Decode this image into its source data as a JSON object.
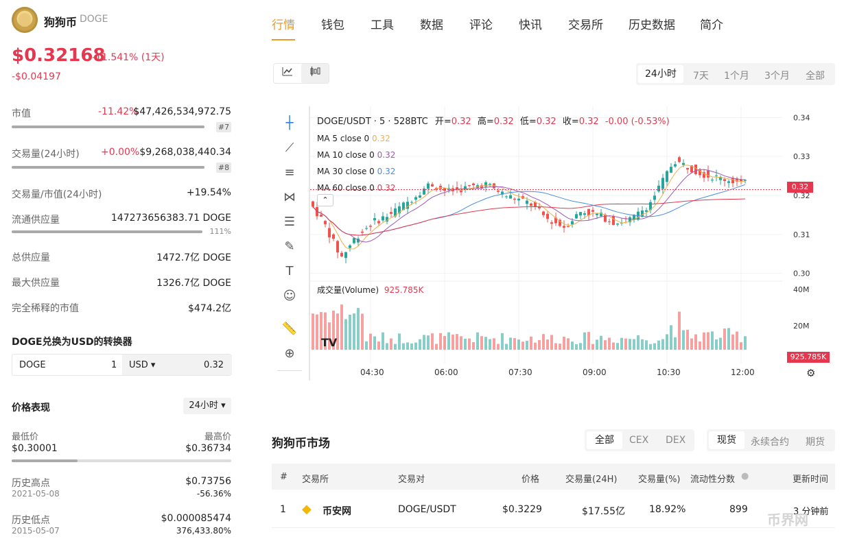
{
  "coin": {
    "name": "狗狗币",
    "symbol": "DOGE",
    "price": "$0.32168",
    "change_pct": "-11.541% (1天)",
    "change_abs": "-$0.04197"
  },
  "stats": [
    {
      "label": "市值",
      "pct": "-11.42%",
      "value": "$47,426,534,972.75",
      "rank": "#7",
      "bar": 0.94
    },
    {
      "label": "交易量(24小时)",
      "pct": "+0.00%",
      "value": "$9,268,038,440.34",
      "rank": "#8",
      "bar": 0.94
    },
    {
      "label": "交易量/市值(24小时)",
      "value": "+19.54%"
    },
    {
      "label": "流通供应量",
      "value": "147273656383.71 DOGE",
      "sub": "111%",
      "bar": 1.0
    },
    {
      "label": "总供应量",
      "value": "1472.7亿 DOGE"
    },
    {
      "label": "最大供应量",
      "value": "1326.7亿 DOGE"
    },
    {
      "label": "完全稀释的市值",
      "value": "$474.2亿"
    }
  ],
  "converter": {
    "title": "DOGE兑换为USD的转换器",
    "from": "DOGE",
    "from_amount": "1",
    "to": "USD ▾",
    "to_amount": "0.32"
  },
  "performance": {
    "title": "价格表现",
    "period": "24小时 ▾",
    "low_label": "最低价",
    "low": "$0.30001",
    "high_label": "最高价",
    "high": "$0.36734",
    "range_position": 0.3,
    "ath_label": "历史高点",
    "ath": "$0.73756",
    "ath_date": "2021-05-08",
    "ath_pct": "-56.36%",
    "atl_label": "历史低点",
    "atl": "$0.000085474",
    "atl_date": "2015-05-07",
    "atl_pct": "376,433.80%"
  },
  "tabs": [
    "行情",
    "钱包",
    "工具",
    "数据",
    "评论",
    "快讯",
    "交易所",
    "历史数据",
    "简介"
  ],
  "ranges": [
    "24小时",
    "7天",
    "1个月",
    "3个月",
    "全部"
  ],
  "chart_header": {
    "pair": "DOGE/USDT · 5 · 528BTC",
    "o_label": "开=",
    "o": "0.32",
    "h_label": "高=",
    "h": "0.32",
    "l_label": "低=",
    "l": "0.32",
    "c_label": "收=",
    "c": "0.32",
    "chg": "-0.00 (-0.53%)"
  },
  "ma": [
    {
      "label": "MA 5 close 0",
      "v": "0.32",
      "color": "#f0b04a"
    },
    {
      "label": "MA 10 close 0",
      "v": "0.32",
      "color": "#9b59b6"
    },
    {
      "label": "MA 30 close 0",
      "v": "0.32",
      "color": "#4a8fe0"
    },
    {
      "label": "MA 60 close 0",
      "v": "0.32",
      "color": "#e5384f"
    }
  ],
  "volume_label": {
    "text": "成交量(Volume)",
    "v": "925.785K"
  },
  "colors": {
    "up": "#26a69a",
    "down": "#ef5350",
    "accent": "#e89a2c"
  },
  "chart_data": {
    "type": "candlestick",
    "x_ticks": [
      "04:30",
      "06:00",
      "07:30",
      "09:00",
      "10:30",
      "12:00"
    ],
    "y_ticks": [
      "0.34",
      "0.33",
      "0.32",
      "0.31",
      "0.30"
    ],
    "vol_ticks": [
      "40M",
      "20M"
    ],
    "ylim": [
      0.298,
      0.342
    ],
    "last_price": "0.32",
    "last_volume": "925.785K"
  },
  "market": {
    "title": "狗狗币市场",
    "filter1": [
      "全部",
      "CEX",
      "DEX"
    ],
    "filter2": [
      "现货",
      "永续合约",
      "期货"
    ],
    "headers": [
      "#",
      "交易所",
      "交易对",
      "价格",
      "交易量(24H)",
      "交易量(%)",
      "流动性分数",
      "更新时间"
    ],
    "rows": [
      {
        "rank": "1",
        "exchange": "币安网",
        "pair": "DOGE/USDT",
        "price": "$0.3229",
        "volume": "$17.55亿",
        "share": "18.92%",
        "liquidity": "899",
        "updated": "3 分钟前"
      }
    ]
  },
  "watermark": "币界网"
}
